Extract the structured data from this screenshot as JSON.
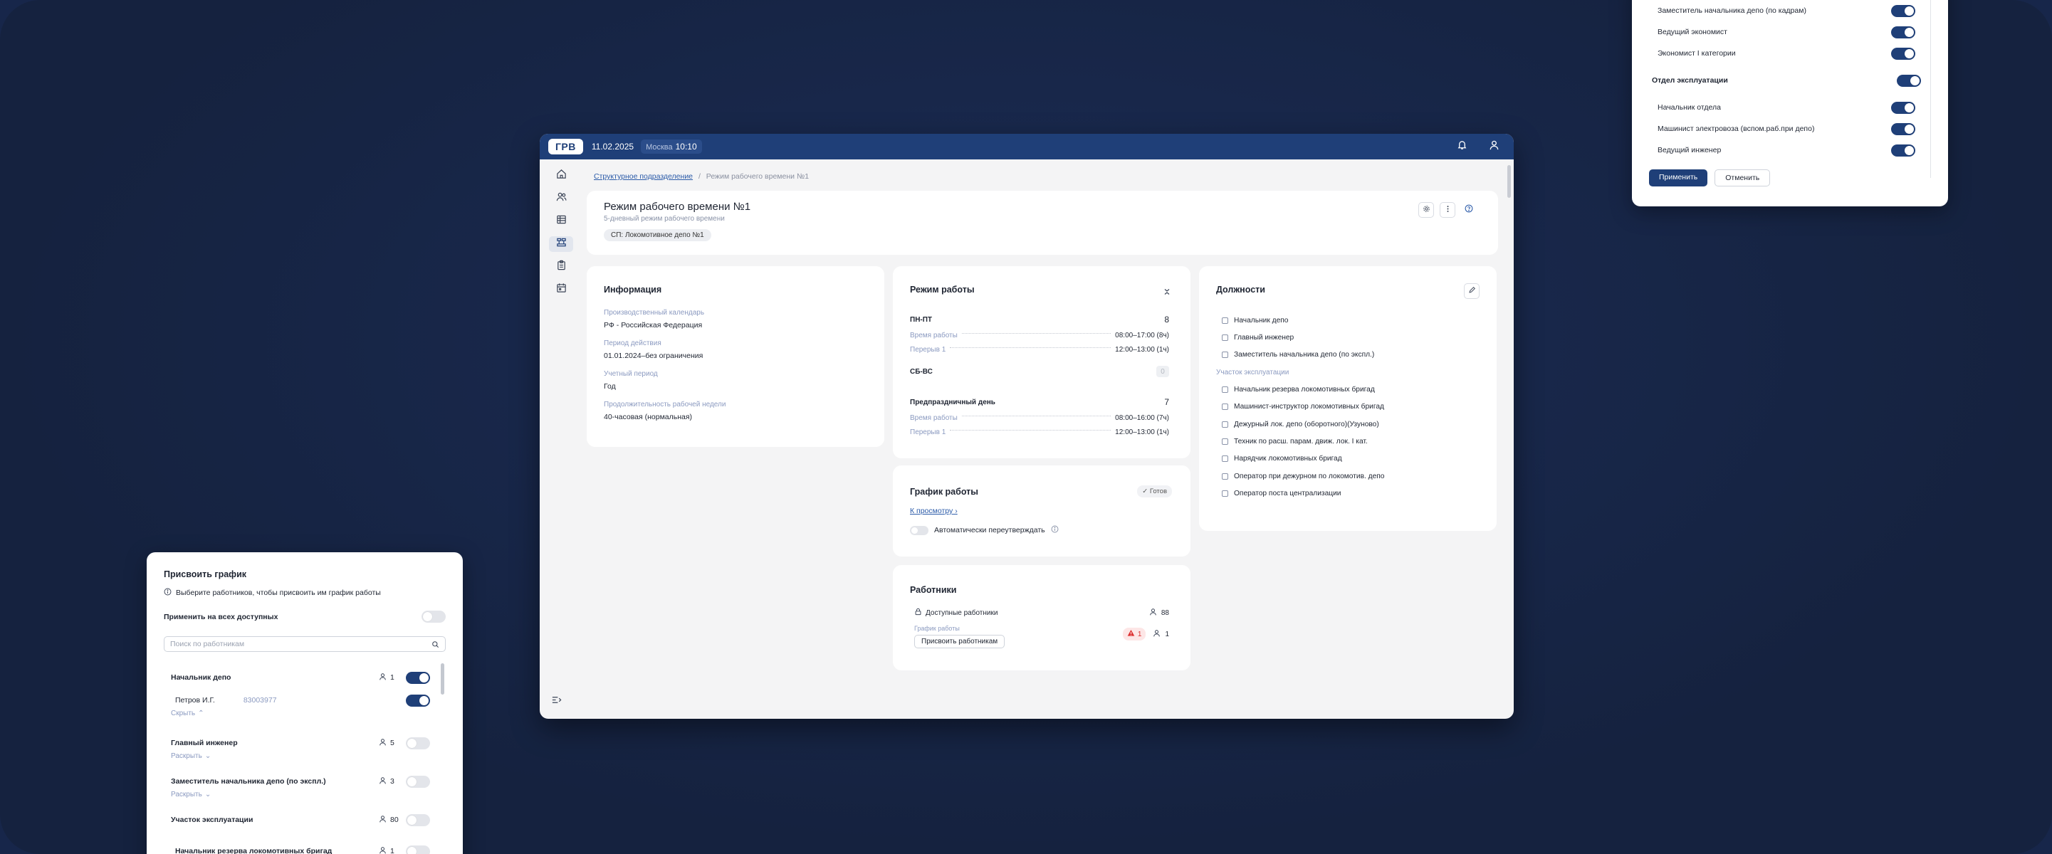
{
  "topbar": {
    "logo": "ГРВ",
    "date": "11.02.2025",
    "tz_city": "Москва",
    "tz_time": "10:10"
  },
  "breadcrumb": {
    "parent": "Структурное подразделение",
    "separator": "/",
    "current": "Режим рабочего времени №1"
  },
  "header": {
    "title": "Режим рабочего времени №1",
    "subtitle": "5-дневный режим рабочего времени",
    "chip": "СП: Локомотивное депо №1"
  },
  "info": {
    "title": "Информация",
    "fields": [
      {
        "label": "Производственный календарь",
        "value": "РФ - Российская Федерация"
      },
      {
        "label": "Период действия",
        "value": "01.01.2024–без ограничения"
      },
      {
        "label": "Учетный период",
        "value": "Год"
      },
      {
        "label": "Продолжительность рабочей недели",
        "value": "40-часовая (нормальная)"
      }
    ]
  },
  "mode": {
    "title": "Режим работы",
    "weekdays": {
      "label": "ПН-ПТ",
      "count": "8",
      "work_label": "Время работы",
      "work_value": "08:00–17:00 (8ч)",
      "break_label": "Перерыв 1",
      "break_value": "12:00–13:00 (1ч)"
    },
    "weekend": {
      "label": "СБ-ВС",
      "count": "0"
    },
    "preholiday": {
      "label": "Предпраздничный день",
      "count": "7",
      "work_label": "Время работы",
      "work_value": "08:00–16:00 (7ч)",
      "break_label": "Перерыв 1",
      "break_value": "12:00–13:00 (1ч)"
    }
  },
  "schedule": {
    "title": "График работы",
    "status": "Готов",
    "view_link": "К просмотру",
    "auto_label": "Автоматически переутверждать"
  },
  "workers": {
    "title": "Работники",
    "available_label": "Доступные работники",
    "available_count": "88",
    "schedule_label": "График работы",
    "assign_button": "Присвоить работникам",
    "warn_count": "1",
    "assigned_count": "1"
  },
  "positions": {
    "title": "Должности",
    "top_items": [
      "Начальник депо",
      "Главный инженер",
      "Заместитель начальника депо (по экспл.)"
    ],
    "group_label": "Участок эксплуатации",
    "group_items": [
      "Начальник резерва локомотивных бригад",
      "Машинист-инструктор локомотивных бригад",
      "Дежурный лок. депо (оборотного)(Узуново)",
      "Техник по расш. парам. движ. лок. I кат.",
      "Нарядчик локомотивных бригад",
      "Оператор при дежурном по локомотив. депо",
      "Оператор поста централизации"
    ]
  },
  "assign": {
    "title": "Присвоить график",
    "hint": "Выберите работников, чтобы присвоить им график работы",
    "apply_all": "Применить на всех доступных",
    "search_placeholder": "Поиск по работникам",
    "rows": [
      {
        "name": "Начальник депо",
        "count": "1"
      },
      {
        "name": "Главный инженер",
        "count": "5"
      },
      {
        "name": "Заместитель начальника депо (по экспл.)",
        "count": "3"
      },
      {
        "name": "Участок эксплуатации",
        "count": "80"
      },
      {
        "name": "Начальник резерва локомотивных бригад",
        "count": "1"
      }
    ],
    "person": {
      "name": "Петров И.Г.",
      "tab": "83003977"
    },
    "hide_label": "Скрыть",
    "expand_label": "Раскрыть"
  },
  "popover": {
    "items": [
      {
        "label": "Заместитель начальника депо (по кадрам)",
        "group": false
      },
      {
        "label": "Ведущий экономист",
        "group": false
      },
      {
        "label": "Экономист I категории",
        "group": false
      },
      {
        "label": "Отдел эксплуатации",
        "group": true
      },
      {
        "label": "Начальник отдела",
        "group": false
      },
      {
        "label": "Машинист электровоза (вспом.раб.при депо)",
        "group": false
      },
      {
        "label": "Ведущий инженер",
        "group": false
      }
    ],
    "apply": "Применить",
    "cancel": "Отменить"
  },
  "colors": {
    "primary": "#1f3f78",
    "background": "#17264a",
    "link": "#2a5aa8",
    "warn": "#d33333"
  }
}
